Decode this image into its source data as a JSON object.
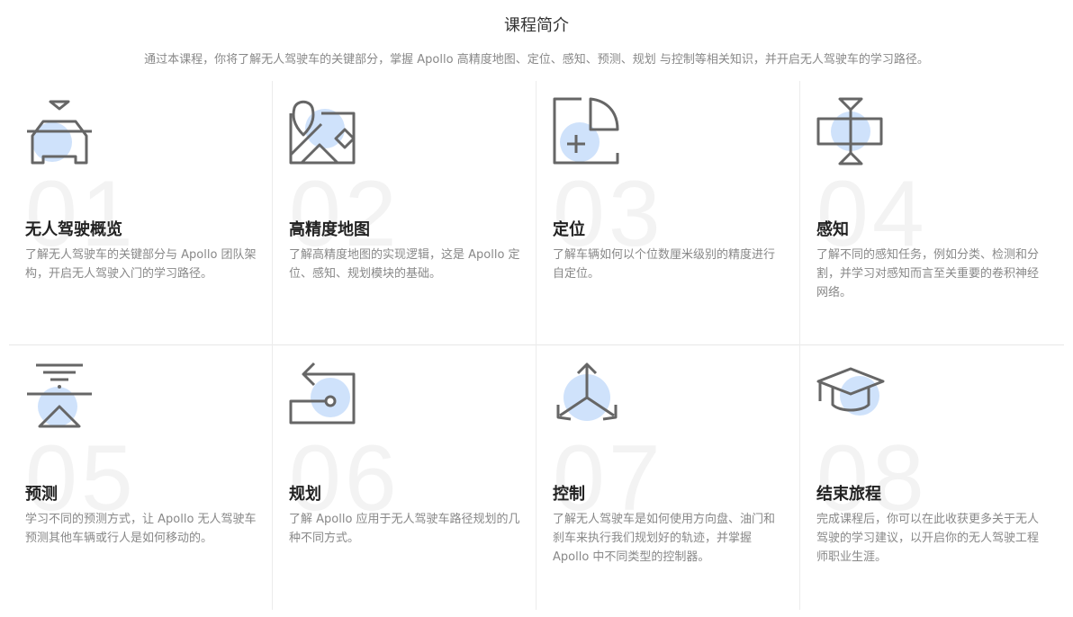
{
  "header": {
    "title": "课程简介",
    "subtitle": "通过本课程，你将了解无人驾驶车的关键部分，掌握 Apollo 高精度地图、定位、感知、预测、规划 与控制等相关知识，并开启无人驾驶车的学习路径。"
  },
  "colors": {
    "accent": "#cfe2fb",
    "icon_stroke": "#666666"
  },
  "cards": [
    {
      "num": "01",
      "icon": "car-icon",
      "title": "无人驾驶概览",
      "desc": "了解无人驾驶车的关键部分与 Apollo 团队架构，开启无人驾驶入门的学习路径。"
    },
    {
      "num": "02",
      "icon": "map-icon",
      "title": "高精度地图",
      "desc": "了解高精度地图的实现逻辑，这是 Apollo 定位、感知、规划模块的基础。"
    },
    {
      "num": "03",
      "icon": "localization-icon",
      "title": "定位",
      "desc": "了解车辆如何以个位数厘米级别的精度进行自定位。"
    },
    {
      "num": "04",
      "icon": "perception-icon",
      "title": "感知",
      "desc": "了解不同的感知任务，例如分类、检测和分割，并学习对感知而言至关重要的卷积神经网络。"
    },
    {
      "num": "05",
      "icon": "prediction-icon",
      "title": "预测",
      "desc": "学习不同的预测方式，让 Apollo 无人驾驶车预测其他车辆或行人是如何移动的。"
    },
    {
      "num": "06",
      "icon": "planning-icon",
      "title": "规划",
      "desc": "了解 Apollo 应用于无人驾驶车路径规划的几种不同方式。"
    },
    {
      "num": "07",
      "icon": "control-icon",
      "title": "控制",
      "desc": "了解无人驾驶车是如何使用方向盘、油门和刹车来执行我们规划好的轨迹，并掌握 Apollo 中不同类型的控制器。"
    },
    {
      "num": "08",
      "icon": "graduation-cap-icon",
      "title": "结束旅程",
      "desc": "完成课程后，你可以在此收获更多关于无人驾驶的学习建议，以开启你的无人驾驶工程师职业生涯。"
    }
  ]
}
